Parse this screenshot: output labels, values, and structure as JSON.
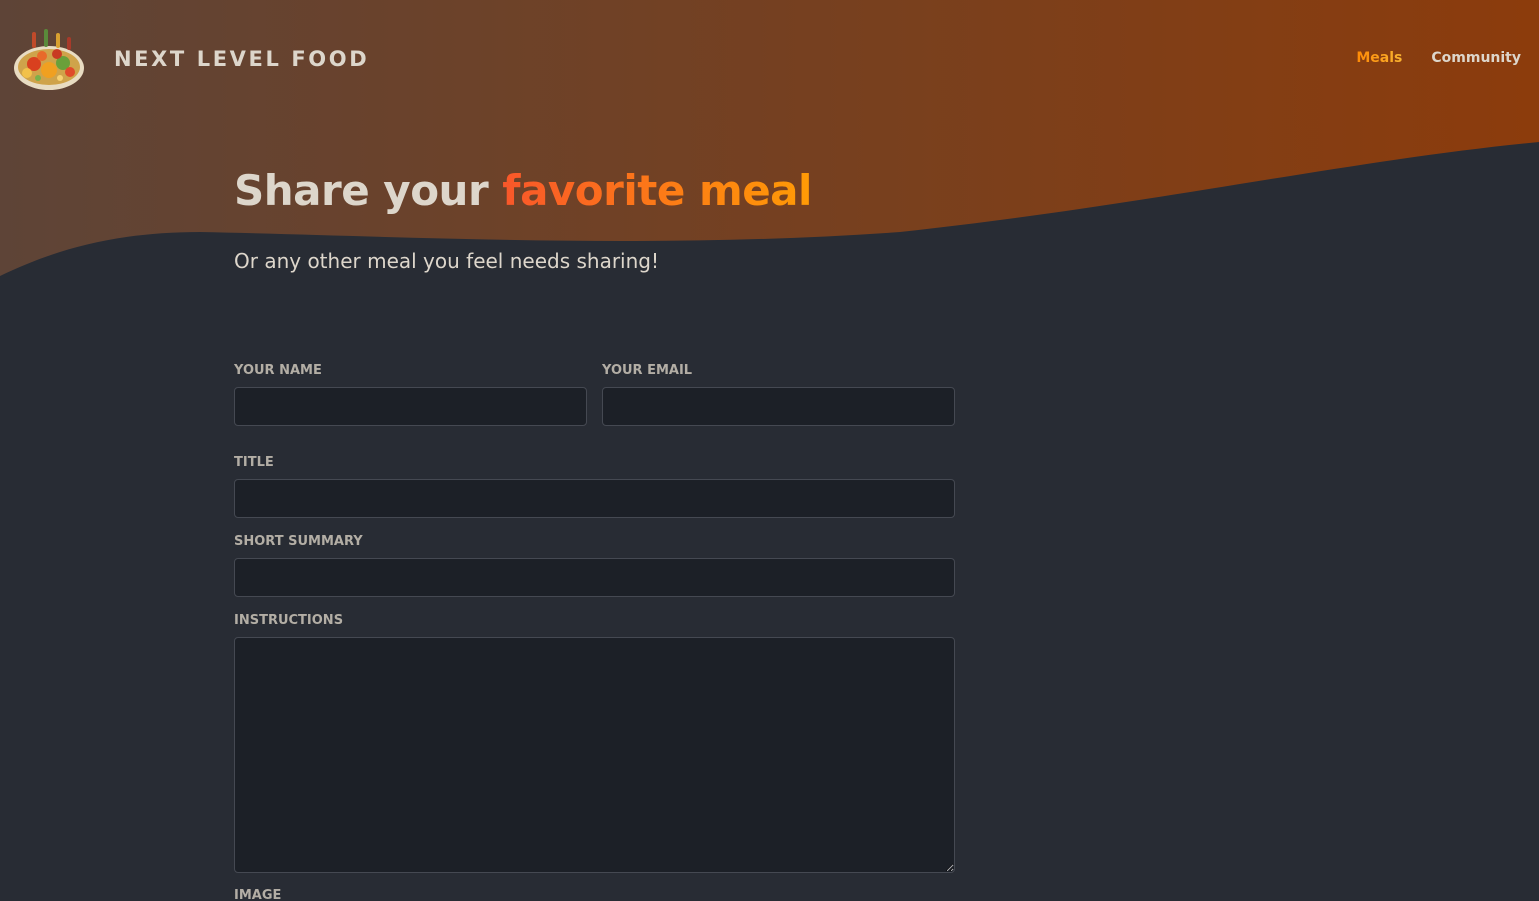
{
  "header": {
    "logo_alt": "A plate with food on it",
    "logo_text": "NEXT LEVEL FOOD",
    "nav": {
      "meals": "Meals",
      "community": "Community"
    },
    "active_nav": "meals"
  },
  "hero": {
    "title_prefix": "Share your",
    "title_highlight": "favorite meal",
    "subtitle": "Or any other meal you feel needs sharing!"
  },
  "form": {
    "name_label": "YOUR NAME",
    "name_value": "",
    "email_label": "YOUR EMAIL",
    "email_value": "",
    "title_label": "TITLE",
    "title_value": "",
    "summary_label": "SHORT SUMMARY",
    "summary_value": "",
    "instructions_label": "INSTRUCTIONS",
    "instructions_value": "",
    "image_label": "IMAGE"
  },
  "colors": {
    "background": "#282c34",
    "header_gradient_start": "#5e4437",
    "header_gradient_end": "#8a3d10",
    "accent_orange": "#f9572a",
    "accent_amber": "#ff9b05",
    "text_light": "#ddd6cb"
  }
}
